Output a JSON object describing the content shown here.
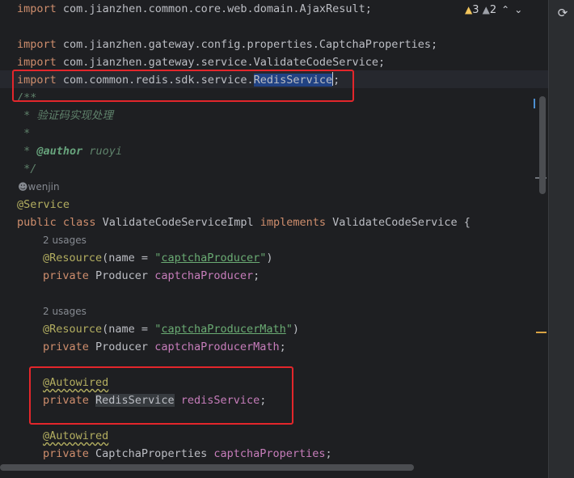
{
  "editor": {
    "lines": {
      "import_ajax": {
        "kw": "import",
        "text": " com.jianzhen.common.core.web.domain.AjaxResult;"
      },
      "import_captcha": {
        "kw": "import",
        "text": " com.jianzhen.gateway.config.properties.CaptchaProperties;"
      },
      "import_validate": {
        "kw": "import",
        "text": " com.jianzhen.gateway.service.ValidateCodeService;"
      },
      "import_redis": {
        "kw": "import",
        "pre": " com.common.redis.sdk.service.",
        "selected": "RedisService",
        "post": ";"
      },
      "doc_open": "/**",
      "doc_desc": " * 验证码实现处理",
      "doc_blank": " *",
      "doc_author_prefix": " * ",
      "doc_author_tag": "@author",
      "doc_author_name": " ruoyi",
      "doc_close": " */",
      "author_hint": "wenjin",
      "service_annotation": "@Service",
      "class_decl": {
        "kw1": "public class",
        "name": " ValidateCodeServiceImpl ",
        "kw2": "implements",
        "rest": " ValidateCodeService {"
      },
      "usages_1": "2 usages",
      "resource_1": {
        "ann": "@Resource",
        "pre": "(name = ",
        "q1": "\"",
        "str": "captchaProducer",
        "q2": "\"",
        "post": ")"
      },
      "field_1": {
        "kw": "private",
        "type": " Producer ",
        "name": "captchaProducer",
        "end": ";"
      },
      "usages_2": "2 usages",
      "resource_2": {
        "ann": "@Resource",
        "pre": "(name = ",
        "q1": "\"",
        "str": "captchaProducerMath",
        "q2": "\"",
        "post": ")"
      },
      "field_2": {
        "kw": "private",
        "type": " Producer ",
        "name": "captchaProducerMath",
        "end": ";"
      },
      "autowired_1": "@Autowired",
      "field_3": {
        "kw": "private",
        "sp": " ",
        "type": "RedisService",
        "sp2": " ",
        "name": "redisService",
        "end": ";"
      },
      "autowired_2": "@Autowired",
      "field_4": {
        "kw": "private",
        "type": " CaptchaProperties ",
        "name": "captchaProperties",
        "end": ";"
      }
    }
  },
  "inspections": {
    "warnings": "3",
    "weak_warnings": "2"
  },
  "colors": {
    "background": "#1e1f22",
    "keyword": "#cf8e6d",
    "annotation": "#b3ae60",
    "field": "#c77dbb",
    "string": "#6aab73",
    "highlight_box": "#e3262b"
  },
  "icons": {
    "warning": "warning-triangle-icon",
    "weak_warning": "weak-warning-triangle-icon",
    "prev": "chevron-up-icon",
    "next": "chevron-down-icon",
    "refresh": "refresh-icon",
    "author": "person-icon"
  }
}
